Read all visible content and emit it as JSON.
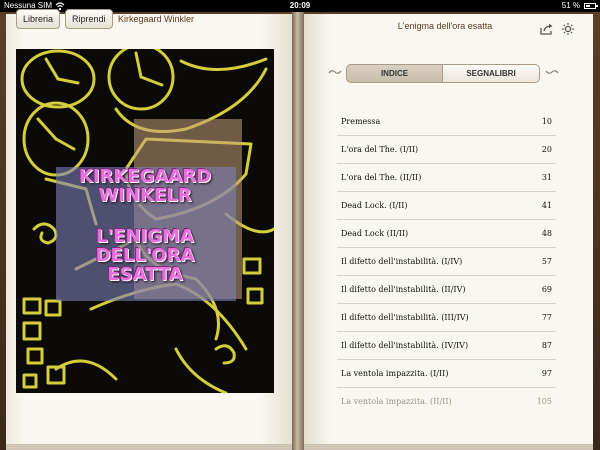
{
  "status_bar": {
    "carrier": "Nessuna SIM",
    "time": "20:09",
    "battery": "51 %",
    "battery_level": 0.51
  },
  "left_toolbar": {
    "library_label": "Libreria",
    "resume_label": "Riprendi",
    "author": "Kirkegaard Winkler"
  },
  "cover": {
    "author_line1": "KIRKEGAARD",
    "author_line2": "WINKELR",
    "title_line1": "L'ENIGMA",
    "title_line2": "DELL'ORA",
    "title_line3": "ESATTA",
    "colors": {
      "background": "#0b0a08",
      "drawing": "#d4cd3c",
      "overlay": "#6b6a9a",
      "text": "#e96ee0"
    }
  },
  "right_toolbar": {
    "book_title": "L'enigma dell'ora esatta",
    "share_icon": "share-icon",
    "brightness_icon": "brightness-icon"
  },
  "tabs": {
    "index_label": "INDICE",
    "bookmarks_label": "SEGNALIBRI",
    "selected": "INDICE"
  },
  "toc": [
    {
      "title": "Premessa",
      "page": "10"
    },
    {
      "title": "L'ora del The. (I/II)",
      "page": "20"
    },
    {
      "title": "L'ora del The. (II/II)",
      "page": "31"
    },
    {
      "title": "Dead Lock. (I/II)",
      "page": "41"
    },
    {
      "title": "Dead Lock (II/II)",
      "page": "48"
    },
    {
      "title": "Il difetto dell'instabilità. (I/IV)",
      "page": "57"
    },
    {
      "title": "Il difetto dell'instabilità. (II/IV)",
      "page": "69"
    },
    {
      "title": "Il difetto dell'instabilità. (III/IV)",
      "page": "77"
    },
    {
      "title": "Il difetto dell'instabilità. (IV/IV)",
      "page": "87"
    },
    {
      "title": "La ventola impazzita. (I/II)",
      "page": "97"
    },
    {
      "title": "La ventola impazzita. (II/II)",
      "page": "105"
    }
  ]
}
